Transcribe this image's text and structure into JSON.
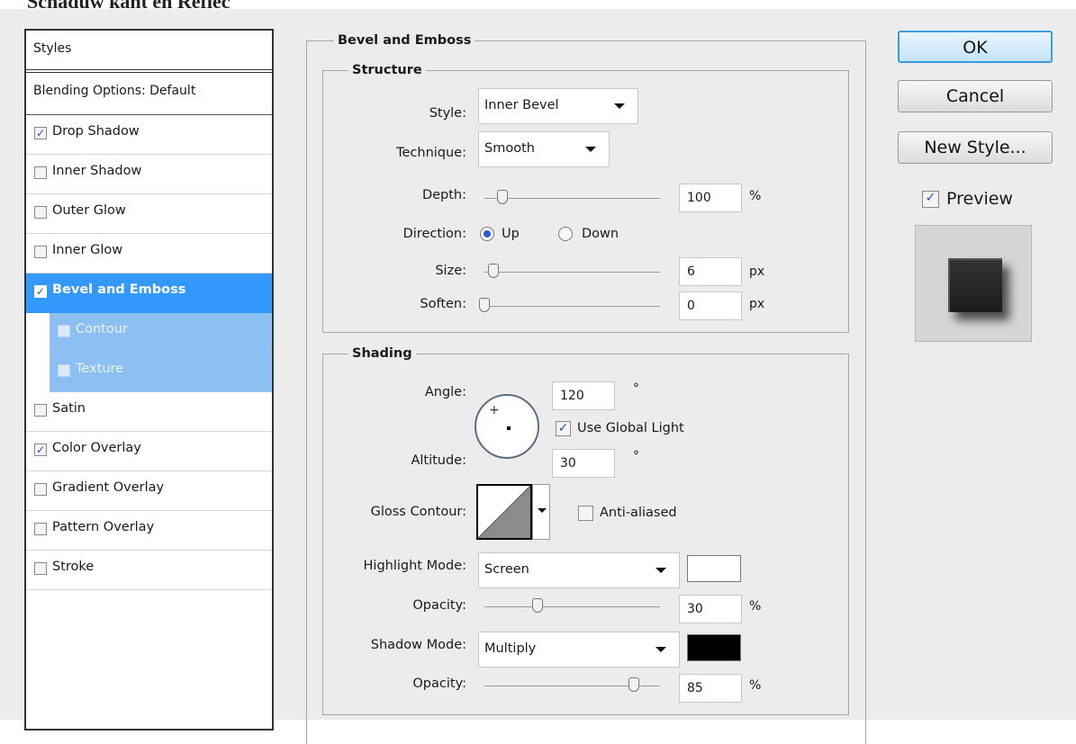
{
  "caption": "Schaduw kant en Reflec",
  "styles": {
    "header": "Styles",
    "blending": "Blending Options: Default",
    "items": [
      {
        "label": "Drop Shadow",
        "checked": true
      },
      {
        "label": "Inner Shadow",
        "checked": false
      },
      {
        "label": "Outer Glow",
        "checked": false
      },
      {
        "label": "Inner Glow",
        "checked": false
      },
      {
        "label": "Bevel and Emboss",
        "checked": true,
        "selected": true
      },
      {
        "label": "Contour",
        "checked": false,
        "sub": true
      },
      {
        "label": "Texture",
        "checked": false,
        "sub": true
      },
      {
        "label": "Satin",
        "checked": false
      },
      {
        "label": "Color Overlay",
        "checked": true
      },
      {
        "label": "Gradient Overlay",
        "checked": false
      },
      {
        "label": "Pattern Overlay",
        "checked": false
      },
      {
        "label": "Stroke",
        "checked": false
      }
    ]
  },
  "bevel": {
    "title": "Bevel and Emboss",
    "structure": {
      "title": "Structure",
      "style_label": "Style:",
      "style_value": "Inner Bevel",
      "technique_label": "Technique:",
      "technique_value": "Smooth",
      "depth_label": "Depth:",
      "depth_value": "100",
      "depth_unit": "%",
      "depth_level": 0.1,
      "direction_label": "Direction:",
      "direction_up": "Up",
      "direction_down": "Down",
      "direction_selected": "Up",
      "size_label": "Size:",
      "size_value": "6",
      "size_unit": "px",
      "size_level": 0.05,
      "soften_label": "Soften:",
      "soften_value": "0",
      "soften_unit": "px",
      "soften_level": 0.0
    },
    "shading": {
      "title": "Shading",
      "angle_label": "Angle:",
      "angle_value": "120",
      "angle_unit": "°",
      "global_light_label": "Use Global Light",
      "global_light_checked": true,
      "altitude_label": "Altitude:",
      "altitude_value": "30",
      "altitude_unit": "°",
      "gloss_label": "Gloss Contour:",
      "anti_aliased_label": "Anti-aliased",
      "anti_aliased_checked": false,
      "highlight_mode_label": "Highlight Mode:",
      "highlight_mode_value": "Screen",
      "highlight_color": "#ffffff",
      "highlight_opacity_label": "Opacity:",
      "highlight_opacity_value": "30",
      "highlight_opacity_unit": "%",
      "highlight_opacity_level": 0.3,
      "shadow_mode_label": "Shadow Mode:",
      "shadow_mode_value": "Multiply",
      "shadow_color": "#000000",
      "shadow_opacity_label": "Opacity:",
      "shadow_opacity_value": "85",
      "shadow_opacity_unit": "%",
      "shadow_opacity_level": 0.85
    }
  },
  "buttons": {
    "ok": "OK",
    "cancel": "Cancel",
    "new_style": "New Style...",
    "preview_label": "Preview",
    "preview_checked": true
  }
}
